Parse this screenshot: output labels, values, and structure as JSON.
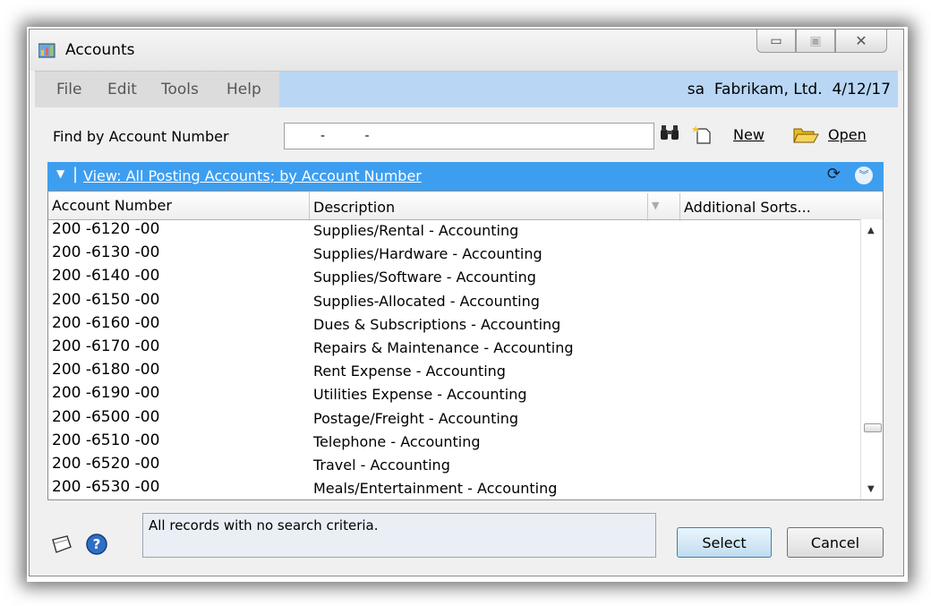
{
  "window": {
    "title": "Accounts"
  },
  "menu": {
    "items": [
      "File",
      "Edit",
      "Tools",
      "Help"
    ]
  },
  "status": {
    "user": "sa",
    "company": "Fabrikam, Ltd.",
    "date": "4/12/17"
  },
  "find": {
    "label": "Find by Account Number",
    "value": "-          -"
  },
  "toolbar": {
    "new_label": "New",
    "open_label": "Open"
  },
  "view": {
    "label": "View: All Posting Accounts; by Account Number"
  },
  "grid": {
    "columns": [
      "Account Number",
      "Description",
      "Additional Sorts..."
    ],
    "rows": [
      {
        "account": "200 -6120 -00",
        "description": "Supplies/Rental - Accounting"
      },
      {
        "account": "200 -6130 -00",
        "description": "Supplies/Hardware - Accounting"
      },
      {
        "account": "200 -6140 -00",
        "description": "Supplies/Software - Accounting"
      },
      {
        "account": "200 -6150 -00",
        "description": "Supplies-Allocated - Accounting"
      },
      {
        "account": "200 -6160 -00",
        "description": "Dues & Subscriptions - Accounting"
      },
      {
        "account": "200 -6170 -00",
        "description": "Repairs & Maintenance - Accounting"
      },
      {
        "account": "200 -6180 -00",
        "description": "Rent Expense - Accounting"
      },
      {
        "account": "200 -6190 -00",
        "description": "Utilities Expense - Accounting"
      },
      {
        "account": "200 -6500 -00",
        "description": "Postage/Freight  - Accounting"
      },
      {
        "account": "200 -6510 -00",
        "description": "Telephone - Accounting"
      },
      {
        "account": "200 -6520 -00",
        "description": "Travel - Accounting"
      },
      {
        "account": "200 -6530 -00",
        "description": "Meals/Entertainment - Accounting"
      }
    ]
  },
  "message": "All records with no search criteria.",
  "buttons": {
    "select": "Select",
    "cancel": "Cancel"
  },
  "colors": {
    "view_bar": "#3d9ef0",
    "status_area": "#b9d7f5",
    "select_border": "#3c7fb1"
  }
}
